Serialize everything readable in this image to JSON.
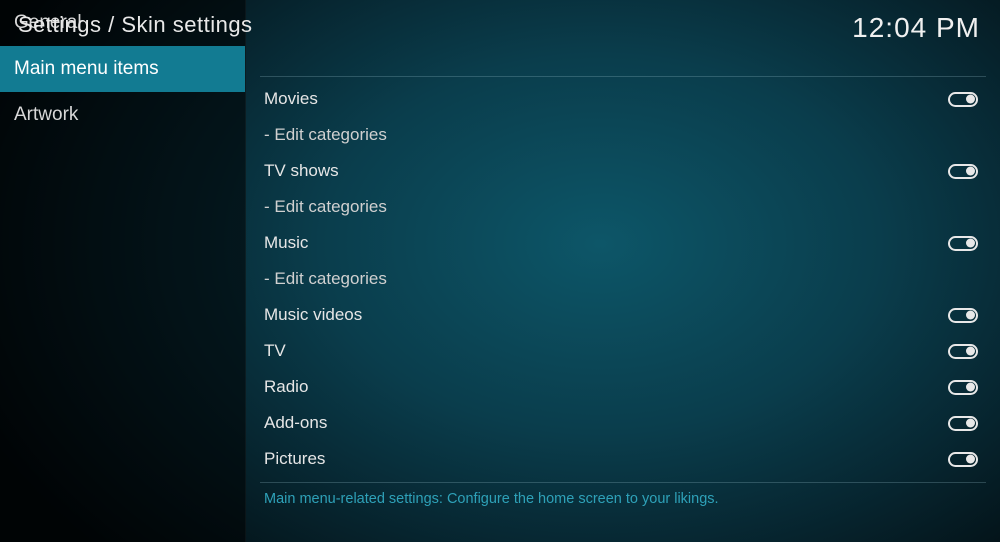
{
  "header": {
    "breadcrumb": "Settings / Skin settings",
    "clock": "12:04 PM"
  },
  "sidebar": {
    "items": [
      {
        "label": "General",
        "active": false
      },
      {
        "label": "Main menu items",
        "active": true
      },
      {
        "label": "Artwork",
        "active": false
      }
    ]
  },
  "settings": {
    "rows": [
      {
        "label": "Movies",
        "type": "toggle",
        "on": true
      },
      {
        "label": "- Edit categories",
        "type": "action"
      },
      {
        "label": "TV shows",
        "type": "toggle",
        "on": true
      },
      {
        "label": "- Edit categories",
        "type": "action"
      },
      {
        "label": "Music",
        "type": "toggle",
        "on": true
      },
      {
        "label": "- Edit categories",
        "type": "action"
      },
      {
        "label": "Music videos",
        "type": "toggle",
        "on": true
      },
      {
        "label": "TV",
        "type": "toggle",
        "on": true
      },
      {
        "label": "Radio",
        "type": "toggle",
        "on": true
      },
      {
        "label": "Add-ons",
        "type": "toggle",
        "on": true
      },
      {
        "label": "Pictures",
        "type": "toggle",
        "on": true
      }
    ]
  },
  "footer": {
    "help": "Main menu-related settings: Configure the home screen to your likings."
  }
}
